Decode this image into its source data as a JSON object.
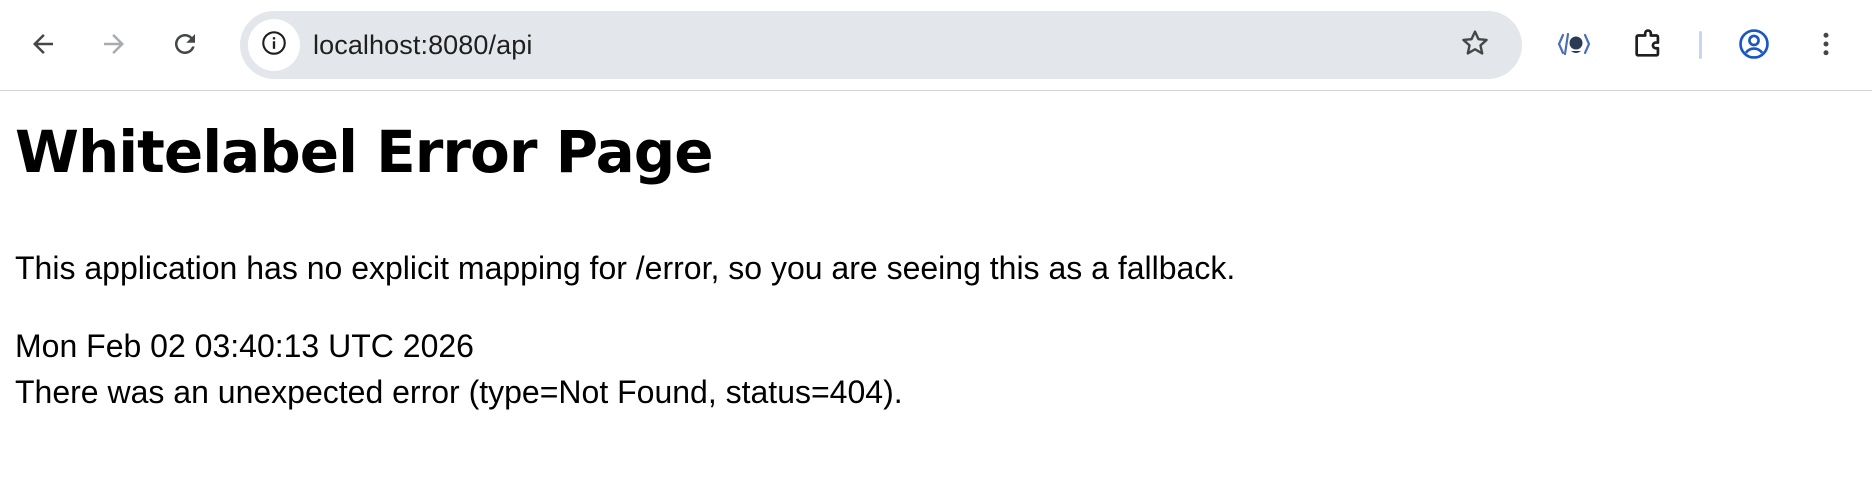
{
  "browser": {
    "address_bar": {
      "url": "localhost:8080/api"
    },
    "icons": {
      "back": "arrow-left-icon",
      "forward": "arrow-right-icon",
      "reload": "reload-icon",
      "site_info": "info-icon",
      "bookmark": "star-icon",
      "extension_1": "github-copilot-icon",
      "extensions": "puzzle-icon",
      "profile": "account-circle-icon",
      "menu": "kebab-menu-icon"
    },
    "colors": {
      "omnibox_bg": "#e3e6ea",
      "profile_accent": "#1a56c4"
    }
  },
  "page": {
    "title": "Whitelabel Error Page",
    "message": "This application has no explicit mapping for /error, so you are seeing this as a fallback.",
    "timestamp": "Mon Feb 02 03:40:13 UTC 2026",
    "error_detail": "There was an unexpected error (type=Not Found, status=404)."
  }
}
